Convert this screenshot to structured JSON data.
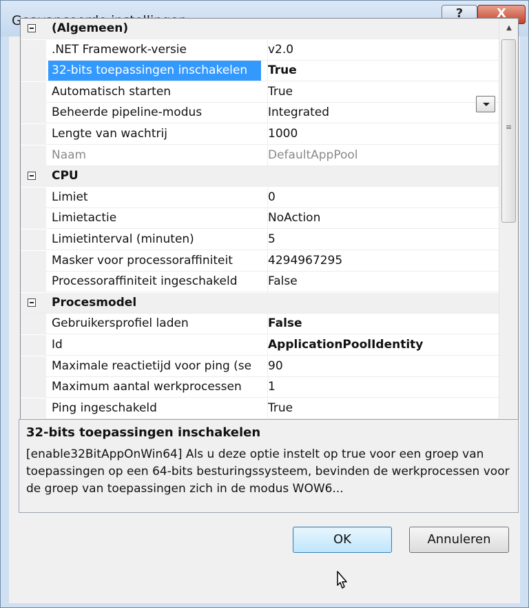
{
  "window": {
    "title": "Geavanceerde instellingen",
    "help_glyph": "?",
    "close_glyph": "X"
  },
  "grid": {
    "rows": [
      {
        "kind": "category",
        "name": "(Algemeen)",
        "value": ""
      },
      {
        "kind": "property",
        "name": ".NET Framework-versie",
        "value": "v2.0",
        "value_bold": false,
        "dim": false,
        "selected": false
      },
      {
        "kind": "property",
        "name": "32-bits toepassingen inschakelen",
        "value": "True",
        "value_bold": true,
        "dim": false,
        "selected": true
      },
      {
        "kind": "property",
        "name": "Automatisch starten",
        "value": "True",
        "value_bold": false,
        "dim": false,
        "selected": false
      },
      {
        "kind": "property",
        "name": "Beheerde pipeline-modus",
        "value": "Integrated",
        "value_bold": false,
        "dim": false,
        "selected": false
      },
      {
        "kind": "property",
        "name": "Lengte van wachtrij",
        "value": "1000",
        "value_bold": false,
        "dim": false,
        "selected": false
      },
      {
        "kind": "property",
        "name": "Naam",
        "value": "DefaultAppPool",
        "value_bold": false,
        "dim": true,
        "selected": false
      },
      {
        "kind": "category",
        "name": "CPU",
        "value": ""
      },
      {
        "kind": "property",
        "name": "Limiet",
        "value": "0",
        "value_bold": false,
        "dim": false,
        "selected": false
      },
      {
        "kind": "property",
        "name": "Limietactie",
        "value": "NoAction",
        "value_bold": false,
        "dim": false,
        "selected": false
      },
      {
        "kind": "property",
        "name": "Limietinterval (minuten)",
        "value": "5",
        "value_bold": false,
        "dim": false,
        "selected": false
      },
      {
        "kind": "property",
        "name": "Masker voor processoraffiniteit",
        "value": "4294967295",
        "value_bold": false,
        "dim": false,
        "selected": false
      },
      {
        "kind": "property",
        "name": "Processoraffiniteit ingeschakeld",
        "value": "False",
        "value_bold": false,
        "dim": false,
        "selected": false
      },
      {
        "kind": "category",
        "name": "Procesmodel",
        "value": ""
      },
      {
        "kind": "property",
        "name": "Gebruikersprofiel laden",
        "value": "False",
        "value_bold": true,
        "dim": false,
        "selected": false
      },
      {
        "kind": "property",
        "name": "Id",
        "value": "ApplicationPoolIdentity",
        "value_bold": true,
        "dim": false,
        "selected": false
      },
      {
        "kind": "property",
        "name": "Maximale reactietijd voor ping (se",
        "value": "90",
        "value_bold": false,
        "dim": false,
        "selected": false
      },
      {
        "kind": "property",
        "name": "Maximum aantal werkprocessen",
        "value": "1",
        "value_bold": false,
        "dim": false,
        "selected": false
      },
      {
        "kind": "property",
        "name": "Ping ingeschakeld",
        "value": "True",
        "value_bold": false,
        "dim": false,
        "selected": false
      }
    ]
  },
  "description": {
    "title": "32-bits toepassingen inschakelen",
    "text": "[enable32BitAppOnWin64] Als u deze optie instelt op true voor een groep van toepassingen op een 64-bits besturingssysteem, bevinden de werkprocessen voor de groep van toepassingen zich in de modus WOW6..."
  },
  "buttons": {
    "ok": "OK",
    "cancel": "Annuleren"
  },
  "icons": {
    "toggle": "collapse-minus-icon",
    "dropdown": "chevron-down-icon",
    "scroll_up": "▲",
    "scroll_down": "▼",
    "grip": "≡"
  }
}
